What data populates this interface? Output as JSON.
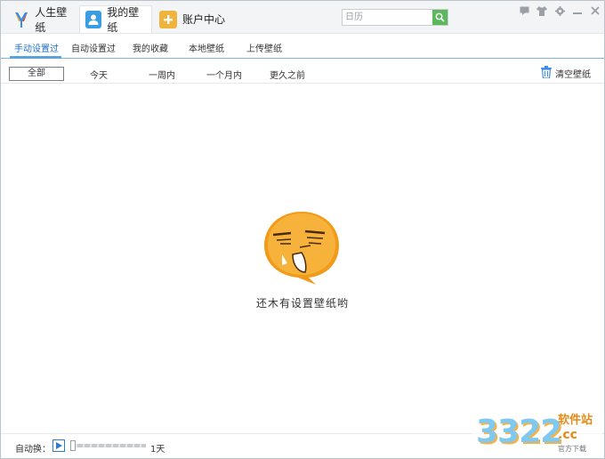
{
  "titlebar": {
    "tabs": [
      {
        "label": "人生壁纸",
        "icon": "app-logo-icon"
      },
      {
        "label": "我的壁纸",
        "icon": "user-icon"
      },
      {
        "label": "账户中心",
        "icon": "plus-icon"
      }
    ],
    "search": {
      "placeholder": "日历",
      "value": ""
    },
    "controls": [
      "feedback-icon",
      "skin-icon",
      "settings-icon",
      "minimize-icon",
      "close-icon"
    ]
  },
  "subnav": {
    "items": [
      "手动设置过",
      "自动设置过",
      "我的收藏",
      "本地壁纸",
      "上传壁纸"
    ],
    "active_index": 0
  },
  "filter": {
    "options": [
      "全部",
      "今天",
      "一周内",
      "一个月内",
      "更久之前"
    ],
    "selected_index": 0,
    "clear_label": "清空壁纸"
  },
  "empty_state": {
    "message": "还木有设置壁纸哟"
  },
  "bottombar": {
    "auto_label": "自动换：",
    "interval": "1天",
    "slider_position": 0
  },
  "watermark": {
    "big": "3322",
    "site": "软件站",
    "cc": ".cc",
    "small": "官方下载"
  },
  "colors": {
    "accent": "#5aa2e2",
    "search_button": "#5cb85c",
    "face_orange": "#f5a623"
  }
}
